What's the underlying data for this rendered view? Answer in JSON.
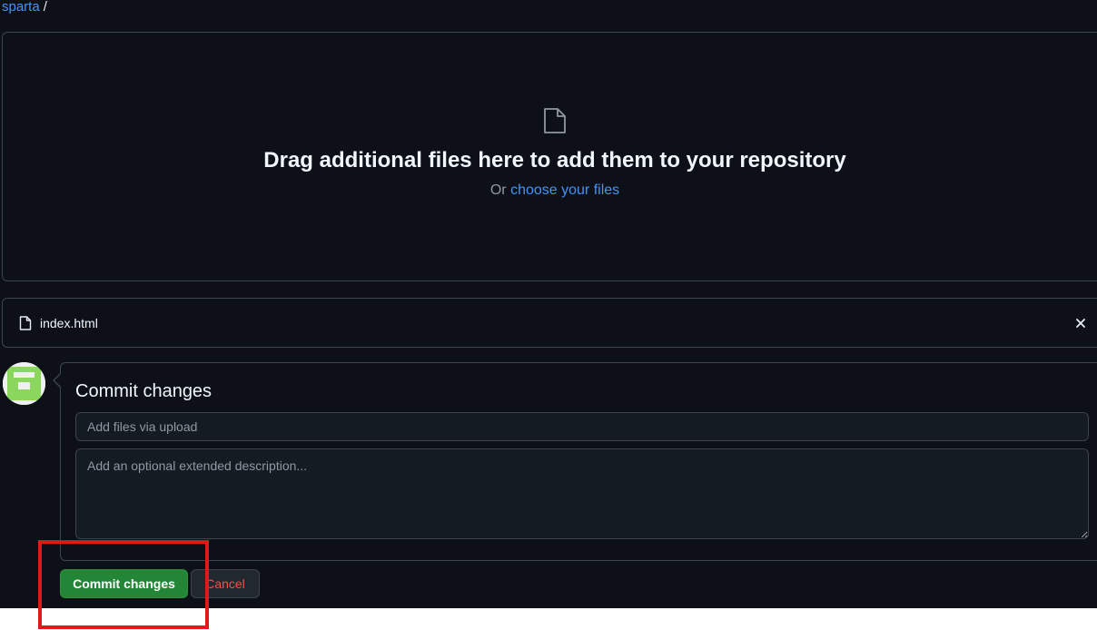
{
  "breadcrumb": {
    "repo": "sparta",
    "separator": "/"
  },
  "dropzone": {
    "icon": "file-icon",
    "title": "Drag additional files here to add them to your repository",
    "or_text": "Or",
    "choose_link": "choose your files"
  },
  "files": [
    {
      "icon": "file-icon",
      "name": "index.html",
      "remove_icon": "close-icon"
    }
  ],
  "commit": {
    "title": "Commit changes",
    "summary_placeholder": "Add files via upload",
    "summary_value": "",
    "description_placeholder": "Add an optional extended description...",
    "description_value": "",
    "commit_button": "Commit changes",
    "cancel_button": "Cancel"
  },
  "colors": {
    "background": "#0d1117",
    "border": "#3d444d",
    "link": "#4493f8",
    "primary_button": "#238636",
    "danger_text": "#f85149",
    "highlight_box": "#e0191c"
  }
}
